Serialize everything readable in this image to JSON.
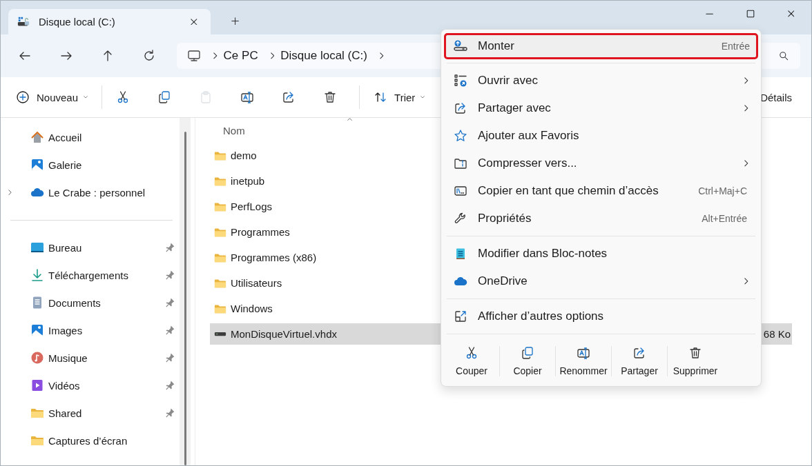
{
  "window": {
    "tab_title": "Disque local (C:)"
  },
  "address_bar": {
    "path": [
      "Ce PC",
      "Disque local (C:)"
    ]
  },
  "toolbar": {
    "new_label": "Nouveau",
    "actions": [
      {
        "disabled": false
      },
      {
        "disabled": false
      },
      {
        "disabled": true
      },
      {
        "disabled": false
      },
      {
        "disabled": false
      },
      {
        "disabled": false
      }
    ],
    "sort_label": "Trier",
    "view_label": "Détails"
  },
  "sidebar": {
    "top": [
      {
        "label": "Accueil",
        "expandable": false
      },
      {
        "label": "Galerie",
        "expandable": false
      },
      {
        "label": "Le Crabe : personnel",
        "expandable": true
      }
    ],
    "places": [
      {
        "label": "Bureau",
        "pinned": true
      },
      {
        "label": "Téléchargements",
        "pinned": true
      },
      {
        "label": "Documents",
        "pinned": true
      },
      {
        "label": "Images",
        "pinned": true
      },
      {
        "label": "Musique",
        "pinned": true
      },
      {
        "label": "Vidéos",
        "pinned": true
      },
      {
        "label": "Shared",
        "pinned": true
      },
      {
        "label": "Captures d’écran",
        "pinned": false
      }
    ]
  },
  "files": {
    "column": "Nom",
    "rows": [
      {
        "name": "demo",
        "kind": "folder",
        "selected": false
      },
      {
        "name": "inetpub",
        "kind": "folder",
        "selected": false
      },
      {
        "name": "PerfLogs",
        "kind": "folder",
        "selected": false
      },
      {
        "name": "Programmes",
        "kind": "folder",
        "selected": false
      },
      {
        "name": "Programmes (x86)",
        "kind": "folder",
        "selected": false
      },
      {
        "name": "Utilisateurs",
        "kind": "folder",
        "selected": false
      },
      {
        "name": "Windows",
        "kind": "folder",
        "selected": false
      },
      {
        "name": "MonDisqueVirtuel.vhdx",
        "kind": "disk",
        "selected": true,
        "size": "68 Ko"
      }
    ]
  },
  "context_menu": {
    "items": [
      {
        "kind": "item",
        "label": "Monter",
        "shortcut": "Entrée",
        "submenu": false,
        "highlighted": true
      },
      {
        "kind": "separator"
      },
      {
        "kind": "item",
        "label": "Ouvrir avec",
        "submenu": true,
        "highlighted": false
      },
      {
        "kind": "item",
        "label": "Partager avec",
        "submenu": true,
        "highlighted": false
      },
      {
        "kind": "item",
        "label": "Ajouter aux Favoris",
        "submenu": false,
        "highlighted": false
      },
      {
        "kind": "item",
        "label": "Compresser vers...",
        "submenu": true,
        "highlighted": false
      },
      {
        "kind": "item",
        "label": "Copier en tant que chemin d’accès",
        "shortcut": "Ctrl+Maj+C",
        "submenu": false,
        "highlighted": false
      },
      {
        "kind": "item",
        "label": "Propriétés",
        "shortcut": "Alt+Entrée",
        "submenu": false,
        "highlighted": false
      },
      {
        "kind": "separator"
      },
      {
        "kind": "item",
        "label": "Modifier dans Bloc-notes",
        "submenu": false,
        "highlighted": false
      },
      {
        "kind": "item",
        "label": "OneDrive",
        "submenu": true,
        "highlighted": false
      },
      {
        "kind": "separator"
      },
      {
        "kind": "item",
        "label": "Afficher d’autres options",
        "submenu": false,
        "highlighted": false
      },
      {
        "kind": "separator"
      }
    ],
    "actions": [
      {
        "label": "Couper"
      },
      {
        "label": "Copier"
      },
      {
        "label": "Renommer"
      },
      {
        "label": "Partager"
      },
      {
        "label": "Supprimer"
      }
    ]
  }
}
